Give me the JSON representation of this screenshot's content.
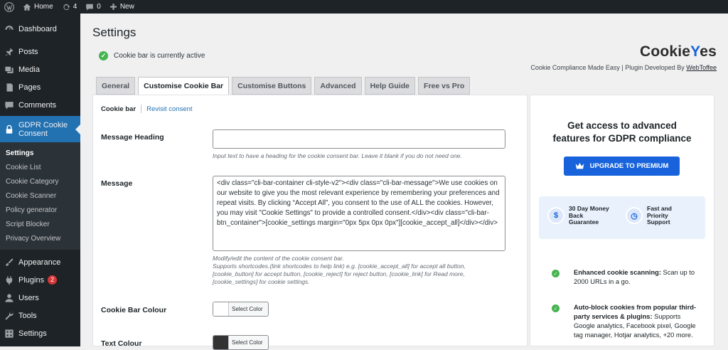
{
  "adminbar": {
    "home_label": "Home",
    "updates_count": "4",
    "comments_count": "0",
    "new_label": "New"
  },
  "sidebar": {
    "items_top": [
      {
        "label": "Dashboard"
      },
      {
        "label": "Posts"
      },
      {
        "label": "Media"
      },
      {
        "label": "Pages"
      },
      {
        "label": "Comments"
      }
    ],
    "active_item": {
      "label_line1": "GDPR Cookie",
      "label_line2": "Consent"
    },
    "submenu": [
      "Settings",
      "Cookie List",
      "Cookie Category",
      "Cookie Scanner",
      "Policy generator",
      "Script Blocker",
      "Privacy Overview"
    ],
    "items_bottom": [
      {
        "label": "Appearance"
      },
      {
        "label": "Plugins",
        "badge": "2"
      },
      {
        "label": "Users"
      },
      {
        "label": "Tools"
      },
      {
        "label": "Settings"
      }
    ]
  },
  "page": {
    "title": "Settings",
    "notice": "Cookie bar is currently active"
  },
  "brand": {
    "logo_prefix": "Cookie",
    "logo_accent": "Y",
    "logo_suffix": "es",
    "tagline_prefix": "Cookie Compliance Made Easy | Plugin Developed By ",
    "tagline_link": "WebToffee"
  },
  "tabs": [
    "General",
    "Customise Cookie Bar",
    "Customise Buttons",
    "Advanced",
    "Help Guide",
    "Free vs Pro"
  ],
  "subtabs": {
    "first": "Cookie bar",
    "second": "Revisit consent"
  },
  "form": {
    "heading_label": "Message Heading",
    "heading_value": "",
    "heading_help": "Input text to have a heading for the cookie consent bar. Leave it blank if you do not need one.",
    "message_label": "Message",
    "message_value": "<div class=\"cli-bar-container cli-style-v2\"><div class=\"cli-bar-message\">We use cookies on our website to give you the most relevant experience by remembering your preferences and repeat visits. By clicking “Accept All”, you consent to the use of ALL the cookies. However, you may visit \"Cookie Settings\" to provide a controlled consent.</div><div class=\"cli-bar-btn_container\">[cookie_settings margin=\"0px 5px 0px 0px\"][cookie_accept_all]</div></div>",
    "message_help1": "Modify/edit the content of the cookie consent bar.",
    "message_help2": "Supports shortcodes.(link shortcodes to help link) e.g. [cookie_accept_all] for accept all button, [cookie_button] for accept button, [cookie_reject] for reject button, [cookie_link] for Read more, [cookie_settings] for cookie settings.",
    "bar_colour_label": "Cookie Bar Colour",
    "text_colour_label": "Text Colour",
    "select_color": "Select Color",
    "bar_colour": "#ffffff",
    "text_colour": "#333333"
  },
  "promo": {
    "heading_line1": "Get access to advanced",
    "heading_line2": "features for GDPR compliance",
    "upgrade_label": "UPGRADE TO PREMIUM",
    "guarantee1": [
      "30 Day Money",
      "Back",
      "Guarantee"
    ],
    "guarantee2": [
      "Fast and",
      "Priority",
      "Support"
    ],
    "feature1_bold": "Enhanced cookie scanning:",
    "feature1_text": " Scan up to 2000 URLs in a go.",
    "feature2_bold": "Auto-block cookies from popular third-party services & plugins:",
    "feature2_text": " Supports Google analytics, Facebook pixel, Google tag manager, Hotjar analytics, +20 more."
  },
  "colors": {
    "accent": "#2271b1",
    "brand": "#1863dc",
    "success": "#46b450"
  }
}
